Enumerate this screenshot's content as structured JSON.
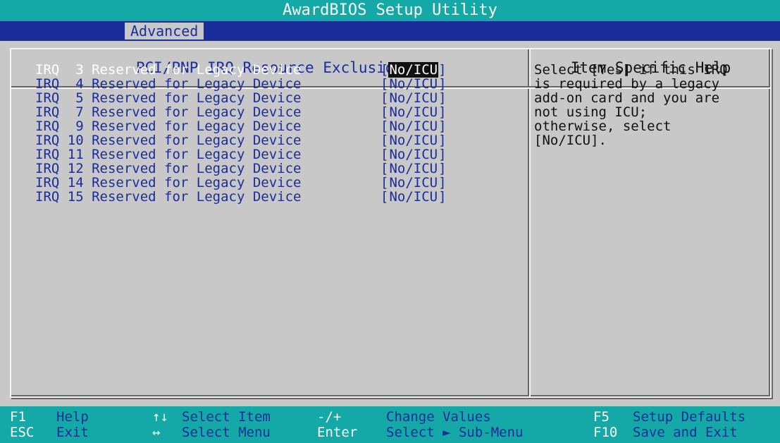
{
  "title": "AwardBIOS Setup Utility",
  "menu": {
    "active_tab": "Advanced"
  },
  "panel": {
    "title": "PCI/PNP IRQ Resource Exclusion"
  },
  "help": {
    "title": "Item Specific Help",
    "lines": [
      "Select [Yes] if this IRQ",
      "is required by a legacy",
      "add-on card and you are",
      "not using ICU;",
      "otherwise, select",
      "[No/ICU]."
    ]
  },
  "irq_items": [
    {
      "label": "IRQ  3 Reserved for Legacy Device",
      "value_open": "[",
      "value": "No/ICU",
      "value_close": "]"
    },
    {
      "label": "IRQ  4 Reserved for Legacy Device",
      "value_open": "[",
      "value": "No/ICU",
      "value_close": "]"
    },
    {
      "label": "IRQ  5 Reserved for Legacy Device",
      "value_open": "[",
      "value": "No/ICU",
      "value_close": "]"
    },
    {
      "label": "IRQ  7 Reserved for Legacy Device",
      "value_open": "[",
      "value": "No/ICU",
      "value_close": "]"
    },
    {
      "label": "IRQ  9 Reserved for Legacy Device",
      "value_open": "[",
      "value": "No/ICU",
      "value_close": "]"
    },
    {
      "label": "IRQ 10 Reserved for Legacy Device",
      "value_open": "[",
      "value": "No/ICU",
      "value_close": "]"
    },
    {
      "label": "IRQ 11 Reserved for Legacy Device",
      "value_open": "[",
      "value": "No/ICU",
      "value_close": "]"
    },
    {
      "label": "IRQ 12 Reserved for Legacy Device",
      "value_open": "[",
      "value": "No/ICU",
      "value_close": "]"
    },
    {
      "label": "IRQ 14 Reserved for Legacy Device",
      "value_open": "[",
      "value": "No/ICU",
      "value_close": "]"
    },
    {
      "label": "IRQ 15 Reserved for Legacy Device",
      "value_open": "[",
      "value": "No/ICU",
      "value_close": "]"
    }
  ],
  "selected_index": 0,
  "status_bar": {
    "row1": [
      {
        "key": "F1",
        "desc": "Help"
      },
      {
        "key": "↑↓",
        "desc": "Select Item"
      },
      {
        "key": "-/+",
        "desc": "Change Values"
      },
      {
        "key": "F5",
        "desc": "Setup Defaults"
      }
    ],
    "row2": [
      {
        "key": "ESC",
        "desc": "Exit"
      },
      {
        "key": "↔",
        "desc": "Select Menu"
      },
      {
        "key": "Enter",
        "desc": "Select ► Sub-Menu"
      },
      {
        "key": "F10",
        "desc": "Save and Exit"
      }
    ]
  },
  "colors": {
    "background": "#c8c8c8",
    "title_bar": "#14a8a6",
    "menu_bar": "#1a2d9a",
    "item_text": "#1a2d9a",
    "highlight": "#ffffff"
  }
}
